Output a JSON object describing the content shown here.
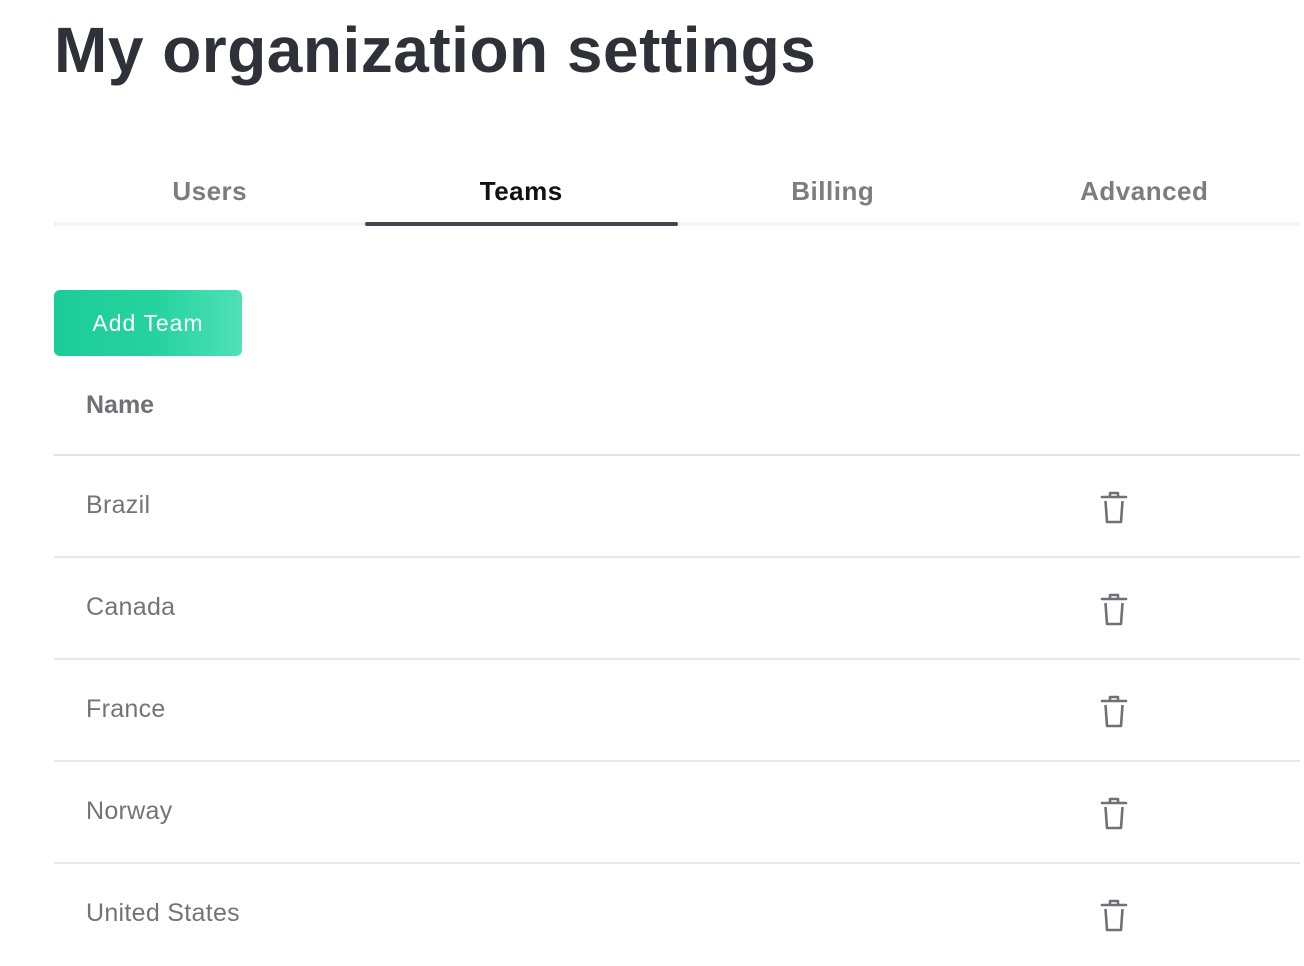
{
  "page": {
    "title": "My organization settings"
  },
  "tabs": [
    {
      "label": "Users",
      "active": false
    },
    {
      "label": "Teams",
      "active": true
    },
    {
      "label": "Billing",
      "active": false
    },
    {
      "label": "Advanced",
      "active": false
    }
  ],
  "actions": {
    "add_team_label": "Add Team"
  },
  "table": {
    "columns": [
      "Name"
    ],
    "rows": [
      {
        "name": "Brazil",
        "action_icon": "trash-icon"
      },
      {
        "name": "Canada",
        "action_icon": "trash-icon"
      },
      {
        "name": "France",
        "action_icon": "trash-icon"
      },
      {
        "name": "Norway",
        "action_icon": "trash-icon"
      },
      {
        "name": "United States",
        "action_icon": "trash-icon"
      }
    ]
  },
  "colors": {
    "accent": "#1ccc98",
    "active_tab_indicator": "#3f4451",
    "title_text": "#2e3138"
  }
}
